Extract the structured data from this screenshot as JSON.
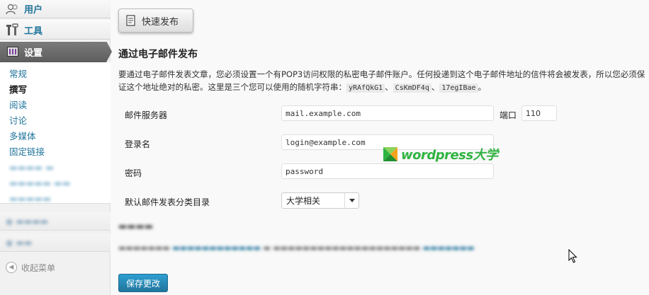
{
  "sidebar": {
    "users_label": "用户",
    "tools_label": "工具",
    "settings_label": "设置",
    "submenu": [
      {
        "label": "常规"
      },
      {
        "label": "撰写"
      },
      {
        "label": "阅读"
      },
      {
        "label": "讨论"
      },
      {
        "label": "多媒体"
      },
      {
        "label": "固定链接"
      }
    ],
    "collapse_label": "收起菜单"
  },
  "main": {
    "quick_press_label": "快速发布",
    "heading": "通过电子邮件发布",
    "description_prefix": "要通过电子邮件发表文章，您必须设置一个有POP3访问权限的私密电子邮件账户。任何投递到这个电子邮件地址的信件将会被发表，所以您必须保证这个地址绝对的私密。这里是三个您可以使用的随机字符串：",
    "random_strings": [
      "yRAfQkG1",
      "CsKmDF4q",
      "17egIBae"
    ],
    "separator": "、",
    "description_suffix": "。",
    "form": {
      "server_label": "邮件服务器",
      "server_value": "mail.example.com",
      "port_label": "端口",
      "port_value": "110",
      "login_label": "登录名",
      "login_value": "login@example.com",
      "password_label": "密码",
      "password_value": "password",
      "category_label": "默认邮件发表分类目录",
      "category_value": "大学相关"
    },
    "save_label": "保存更改"
  },
  "watermark": {
    "text": "wordpress大学"
  },
  "colors": {
    "link": "#21759b",
    "primary_button": "#21759b",
    "watermark_green": "#2fb341"
  }
}
